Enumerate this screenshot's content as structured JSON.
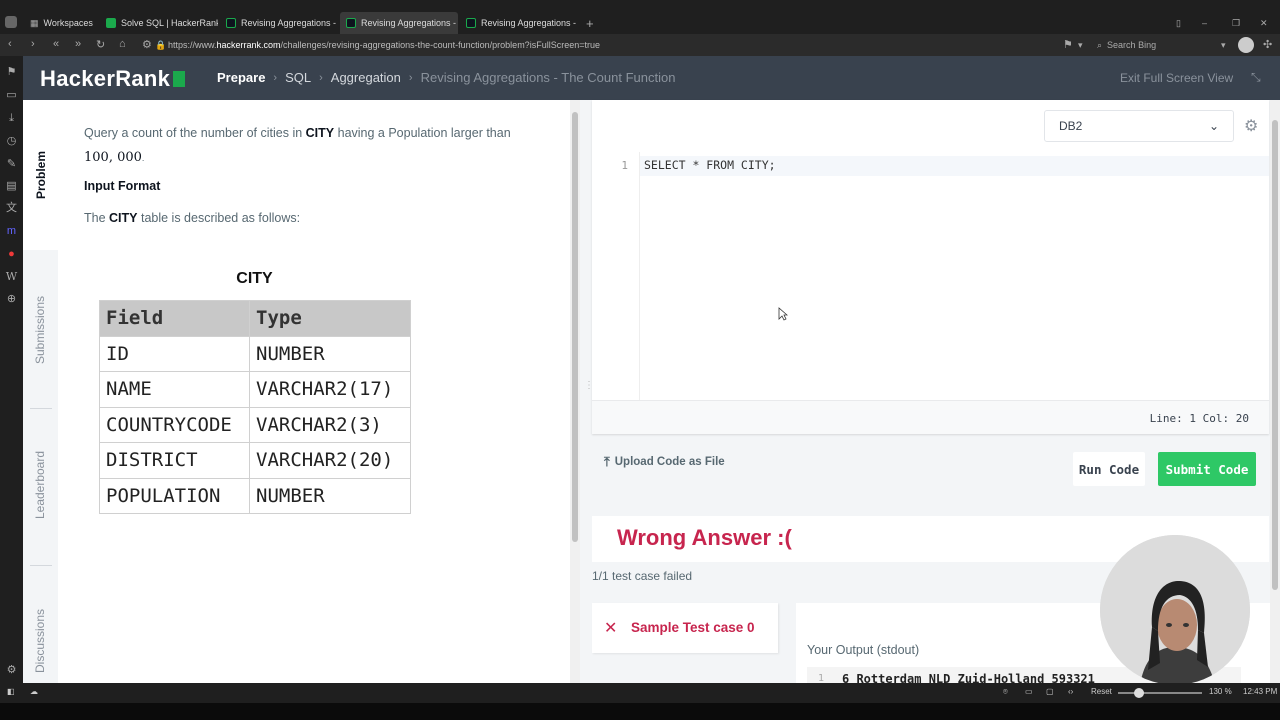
{
  "browser": {
    "workspaces_label": "Workspaces",
    "tabs": [
      {
        "label": "Solve SQL | HackerRank"
      },
      {
        "label": "Revising Aggregations - Th"
      },
      {
        "label": "Revising Aggregations - Th"
      },
      {
        "label": "Revising Aggregations - Av"
      }
    ],
    "url_prefix": "https://www.",
    "url_domain": "hackerrank.com",
    "url_path": "/challenges/revising-aggregations-the-count-function/problem?isFullScreen=true",
    "search_placeholder": "Search Bing",
    "status": {
      "reset_label": "Reset",
      "zoom": "130 %",
      "time": "12:43 PM"
    }
  },
  "header": {
    "logo": "HackerRank",
    "breadcrumbs": [
      "Prepare",
      "SQL",
      "Aggregation",
      "Revising Aggregations - The Count Function"
    ],
    "exit_fullscreen": "Exit Full Screen View"
  },
  "problem": {
    "tabs": [
      "Problem",
      "Submissions",
      "Leaderboard",
      "Discussions"
    ],
    "statement_part1": "Query a count of the number of cities in ",
    "statement_table": "CITY",
    "statement_part2": " having a Population larger than",
    "statement_number": "100, 000",
    "statement_end": ".",
    "input_format_heading": "Input Format",
    "table_desc_prefix": "The ",
    "table_desc_table": "CITY",
    "table_desc_suffix": " table is described as follows:",
    "table": {
      "title": "CITY",
      "headers": [
        "Field",
        "Type"
      ],
      "rows": [
        [
          "ID",
          "NUMBER"
        ],
        [
          "NAME",
          "VARCHAR2(17)"
        ],
        [
          "COUNTRYCODE",
          "VARCHAR2(3)"
        ],
        [
          "DISTRICT",
          "VARCHAR2(20)"
        ],
        [
          "POPULATION",
          "NUMBER"
        ]
      ]
    }
  },
  "editor": {
    "language": "DB2",
    "line_number": "1",
    "code": "SELECT * FROM CITY;",
    "line_col": "Line: 1 Col: 20",
    "upload_label": "Upload Code as File",
    "run_label": "Run Code",
    "submit_label": "Submit Code"
  },
  "result": {
    "verdict": "Wrong Answer :(",
    "summary": "1/1 test case failed",
    "testcase_label": "Sample Test case 0",
    "output_heading": "Your Output (stdout)",
    "output_line_no": "1",
    "output_line": "6 Rotterdam NLD Zuid-Holland 593321"
  },
  "colors": {
    "brand_green": "#1ba94c",
    "submit_green": "#2ec866",
    "header_bg": "#39424e",
    "error_red": "#c7254e"
  }
}
